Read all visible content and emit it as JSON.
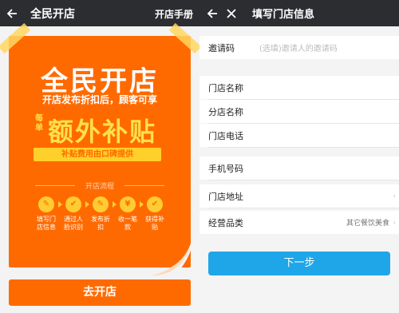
{
  "left": {
    "title": "全民开店",
    "manual_link": "开店手册",
    "poster": {
      "brand": "全民开店",
      "slogan": "开店发布折扣后，顾客可享",
      "per_order": "每单",
      "extra": "额外补贴",
      "subsidy_note": "补贴费用由口碑提供",
      "flow_title": "开店流程",
      "steps": [
        {
          "icon": "✎",
          "label": "填写门店信息"
        },
        {
          "icon": "✔",
          "label": "通过人脸识别"
        },
        {
          "icon": "✎",
          "label": "发布折扣"
        },
        {
          "icon": "¥",
          "label": "收一笔款"
        },
        {
          "icon": "✔",
          "label": "获得补贴"
        }
      ]
    },
    "go_button": "去开店"
  },
  "right": {
    "title": "填写门店信息",
    "invite": {
      "label": "邀请码",
      "placeholder": "(选填)邀请人的邀请码"
    },
    "fields": [
      {
        "label": "门店名称"
      },
      {
        "label": "分店名称"
      },
      {
        "label": "门店电话"
      },
      {
        "label": "手机号码"
      },
      {
        "label": "门店地址"
      },
      {
        "label": "经营品类",
        "value": "其它餐饮美食"
      }
    ],
    "next_button": "下一步"
  },
  "colors": {
    "topbar": "#2c2d31",
    "poster_orange": "#ff6a00",
    "accent_yellow": "#ffe04a",
    "next_blue": "#1fa6e9"
  }
}
